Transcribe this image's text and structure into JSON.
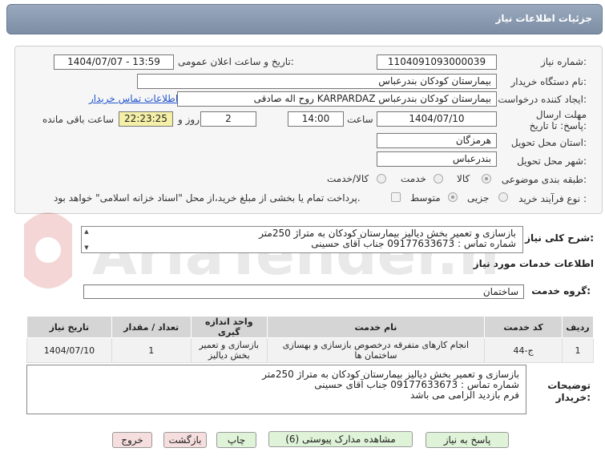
{
  "header": {
    "title": "جزئیات اطلاعات نیاز"
  },
  "labels": {
    "need_number": "شماره نیاز:",
    "announce_datetime": "تاریخ و ساعت اعلان عمومی:",
    "buyer_org": "نام دستگاه خریدار:",
    "requester": "ایجاد کننده درخواست:",
    "deadline": "مهلت ارسال پاسخ: تا تاریخ:",
    "time": "ساعت",
    "day_and": "روز و",
    "remaining": "ساعت باقی مانده",
    "province": "استان محل تحویل:",
    "city": "شهر محل تحویل:",
    "category": "طبقه بندی موضوعی:",
    "purchase_type": "نوع فرآیند خرید :",
    "need_desc": "شرح کلی نیاز:",
    "services_info": "اطلاعات خدمات مورد نیاز",
    "service_group": "گروه خدمت:",
    "buyer_notes": "توضیحات خریدار:"
  },
  "fields": {
    "need_number": "1104091093000039",
    "announce_datetime": "1404/07/07 - 13:59",
    "buyer_org": "بیمارستان کودکان بندرعباس",
    "requester": "روح اله صادقی KARPARDAZ بیمارستان کودکان بندرعباس",
    "contact_link": "اطلاعات تماس خریدار",
    "deadline_date": "1404/07/10",
    "deadline_time": "14:00",
    "days": "2",
    "remaining_time": "22:23:25",
    "province": "هرمزگان",
    "city": "بندرعباس",
    "service_group": "ساختمان"
  },
  "category_options": [
    "کالا",
    "خدمت",
    "کالا/خدمت"
  ],
  "purchase_options": [
    "جزیی",
    "متوسط"
  ],
  "purchase_note": "پرداخت تمام یا بخشی از مبلغ خرید،از محل \"اسناد خزانه اسلامی\" خواهد بود.",
  "need_desc": {
    "line1": "بازسازی و تعمیر بخش دیالیز بیمارستان کودکان به متراژ 250متر",
    "line2": "شماره تماس : 09177633673 جناب آقای حسینی"
  },
  "table": {
    "headers": [
      "ردیف",
      "کد خدمت",
      "نام خدمت",
      "واحد اندازه گیری",
      "تعداد / مقدار",
      "تاریخ نیاز"
    ],
    "rows": [
      [
        "1",
        "ج-44",
        "انجام کارهای متفرقه درخصوص بازسازی و بهسازی ساختمان ها",
        "بازسازی و تعمیر بخش دیالیز",
        "1",
        "1404/07/10"
      ]
    ]
  },
  "buyer_notes": {
    "line1": "بازسازی و تعمیر بخش دیالیز بیمارستان کودکان به متراژ 250متر",
    "line2": "شماره تماس : 09177633673 جناب آقای حسینی",
    "line3": "فرم بازدید الزامی می باشد"
  },
  "buttons": {
    "reply": "پاسخ به نیاز",
    "attachments": "مشاهده مدارک پیوستی (6)",
    "print": "چاپ",
    "back": "بازگشت",
    "exit": "خروج"
  },
  "watermark": {
    "text": "AriaTender.net"
  },
  "colors": {
    "header": "#8898af",
    "green_button": "#dff3d8",
    "pink_button": "#f6dede",
    "remaining_bg": "#f4f0a8"
  }
}
